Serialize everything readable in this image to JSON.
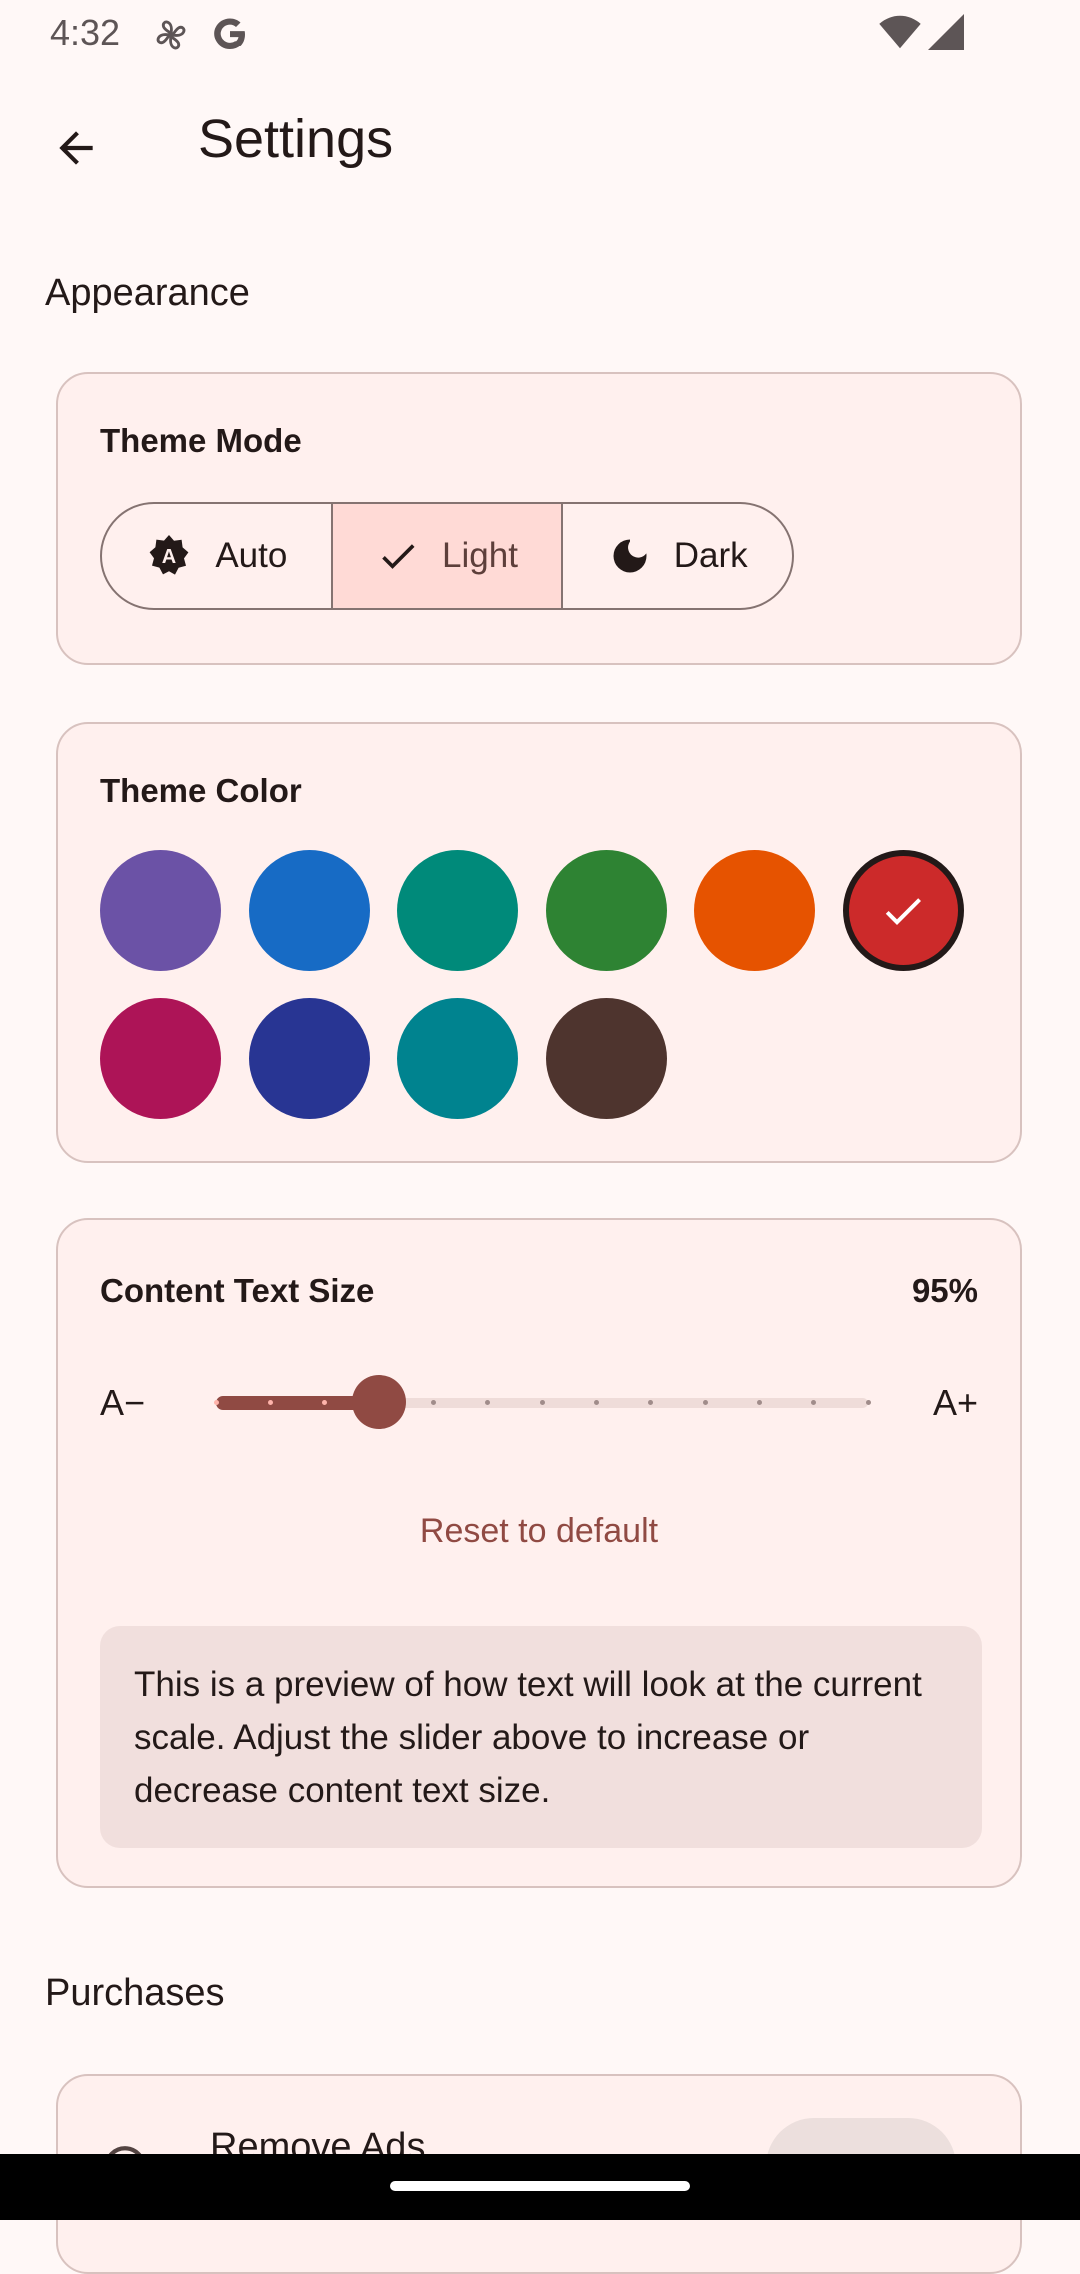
{
  "status_bar": {
    "time": "4:32",
    "icons": [
      "fan-icon",
      "google-icon",
      "wifi-icon",
      "signal-icon"
    ]
  },
  "app_bar": {
    "title": "Settings",
    "back_icon": "arrow-back-icon"
  },
  "appearance": {
    "section_title": "Appearance",
    "theme_mode": {
      "title": "Theme Mode",
      "options": [
        {
          "label": "Auto",
          "icon": "brightness-auto-icon",
          "selected": false
        },
        {
          "label": "Light",
          "icon": "check-icon",
          "selected": true
        },
        {
          "label": "Dark",
          "icon": "moon-icon",
          "selected": false
        }
      ]
    },
    "theme_color": {
      "title": "Theme Color",
      "swatches": [
        {
          "color": "#6b52a6",
          "selected": false
        },
        {
          "color": "#176bc5",
          "selected": false
        },
        {
          "color": "#008a7a",
          "selected": false
        },
        {
          "color": "#2e8333",
          "selected": false
        },
        {
          "color": "#e65300",
          "selected": false
        },
        {
          "color": "#cc2a2a",
          "selected": true
        },
        {
          "color": "#ad1457",
          "selected": false
        },
        {
          "color": "#283593",
          "selected": false
        },
        {
          "color": "#00838f",
          "selected": false
        },
        {
          "color": "#4e342e",
          "selected": false
        }
      ]
    },
    "content_text_size": {
      "title": "Content Text Size",
      "value_label": "95%",
      "decrease_label": "A−",
      "increase_label": "A+",
      "slider_steps": 13,
      "slider_value_index": 3,
      "reset_label": "Reset to default",
      "preview_text": "This is a preview of how text will look at the current scale. Adjust the slider above to increase or decrease content text size."
    }
  },
  "purchases": {
    "section_title": "Purchases",
    "remove_ads_label": "Remove Ads"
  },
  "colors": {
    "accent": "#904a43",
    "background": "#fff8f7",
    "card": "#fff0ee",
    "card_border": "#d8c2bf"
  }
}
